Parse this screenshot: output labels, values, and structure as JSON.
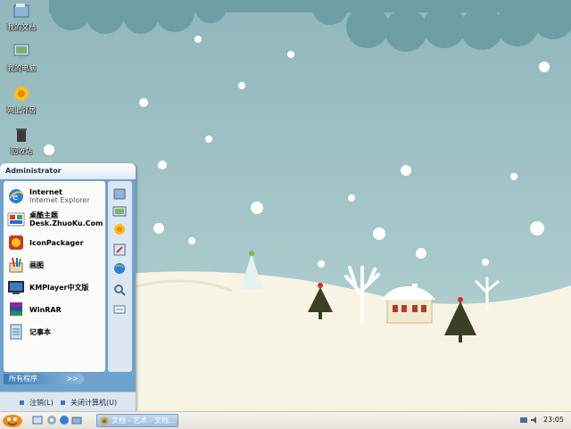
{
  "desktop": {
    "icons": [
      {
        "label": "我的文档"
      },
      {
        "label": "我的电脑"
      },
      {
        "label": "网上邻居"
      },
      {
        "label": "回收站"
      }
    ]
  },
  "start_menu": {
    "user": "Administrator",
    "programs": [
      {
        "name": "Internet",
        "sub": "Internet Explorer",
        "icon": "internet-explorer-icon"
      },
      {
        "name": "桌酷主题",
        "sub": "Desk.ZhuoKu.Com",
        "icon": "zhuoku-theme-icon"
      },
      {
        "name": "IconPackager",
        "sub": "",
        "icon": "iconpackager-icon"
      },
      {
        "name": "画图",
        "sub": "",
        "icon": "paint-icon"
      },
      {
        "name": "KMPlayer中文版",
        "sub": "",
        "icon": "kmplayer-icon"
      },
      {
        "name": "WinRAR",
        "sub": "",
        "icon": "winrar-icon"
      },
      {
        "name": "记事本",
        "sub": "",
        "icon": "notepad-icon"
      }
    ],
    "all_programs": "所有程序",
    "all_programs_arrow": ">>",
    "logoff": "注销(L)",
    "shutdown": "关闭计算机(U)"
  },
  "taskbar": {
    "task_label": "文档 - 艺术 - 文档...",
    "clock": "23:05"
  },
  "colors": {
    "sky": "#9cbfc4",
    "cloud": "#6e9ea4",
    "snow_ground": "#f7f4e4",
    "menu_blue": "#6fa2cc"
  }
}
